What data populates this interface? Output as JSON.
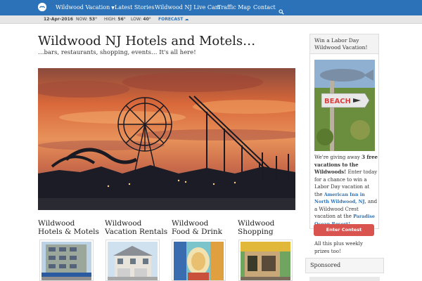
{
  "nav": {
    "items": [
      {
        "label": "Wildwood Vacation",
        "has_dropdown": true
      },
      {
        "label": "Latest Stories"
      },
      {
        "label": "Wildwood NJ Live Cam"
      },
      {
        "label": "Traffic Map"
      },
      {
        "label": "Contact"
      }
    ],
    "logo_icon": "seagull-logo-icon",
    "search_icon": "search-icon",
    "color": "#2b72b8"
  },
  "weather": {
    "date": "12-Apr-2016",
    "now_label": "NOW:",
    "now_value": "53°",
    "high_label": "HIGH:",
    "high_value": "56°",
    "low_label": "LOW:",
    "low_value": "40°",
    "forecast_label": "FORECAST"
  },
  "main": {
    "title": "Wildwood NJ Hotels and Motels…",
    "subtitle": "…bars, restaurants, shopping, events… It's all here!",
    "categories": [
      {
        "line1": "Wildwood",
        "line2": "Hotels & Motels"
      },
      {
        "line1": "Wildwood",
        "line2": "Vacation Rentals"
      },
      {
        "line1": "Wildwood",
        "line2": "Food & Drink"
      },
      {
        "line1": "Wildwood",
        "line2": "Shopping"
      }
    ]
  },
  "sidebar": {
    "promo_title_1": "Win a Labor Day",
    "promo_title_2": "Wildwood Vacation!",
    "sign_text": "BEACH",
    "body_1": "We're giving away",
    "body_bold_1": "3 free vacations to the Wildwoods!",
    "body_2": "Enter today for a chance to win a Labor Day vacation at the",
    "link_1": "American Inn in North Wildwood, NJ",
    "body_3": ", and a Wildwood Crest vacation at the",
    "link_2": "Paradise Ocean Resort!",
    "body_4": "All this plus weekly prizes too!",
    "button_label": "Enter Contest",
    "button_color": "#d9534f",
    "sponsored_label": "Sponsored"
  }
}
